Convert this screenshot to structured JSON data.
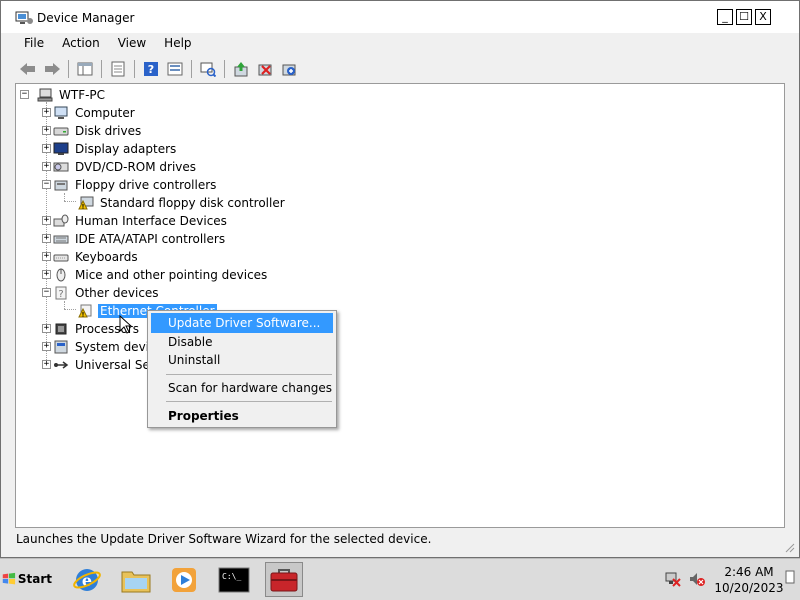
{
  "window": {
    "title": "Device Manager",
    "controls": {
      "minimize": "_",
      "maximize": "☐",
      "close": "X"
    }
  },
  "menu": [
    "File",
    "Action",
    "View",
    "Help"
  ],
  "toolbar": {
    "icons": [
      "back-arrow-icon",
      "forward-arrow-icon",
      "show-hide-tree-icon",
      "properties-sheet-icon",
      "help-icon",
      "view-icon",
      "scan-hardware-icon",
      "update-driver-icon",
      "uninstall-icon",
      "enable-device-icon"
    ]
  },
  "tree": {
    "root": "WTF-PC",
    "categories": [
      {
        "label": "Computer",
        "expander": "+"
      },
      {
        "label": "Disk drives",
        "expander": "+"
      },
      {
        "label": "Display adapters",
        "expander": "+"
      },
      {
        "label": "DVD/CD-ROM drives",
        "expander": "+"
      },
      {
        "label": "Floppy drive controllers",
        "expander": "−",
        "children": [
          "Standard floppy disk controller"
        ]
      },
      {
        "label": "Human Interface Devices",
        "expander": "+"
      },
      {
        "label": "IDE ATA/ATAPI controllers",
        "expander": "+"
      },
      {
        "label": "Keyboards",
        "expander": "+"
      },
      {
        "label": "Mice and other pointing devices",
        "expander": "+"
      },
      {
        "label": "Other devices",
        "expander": "−",
        "children": [
          "Ethernet Controller"
        ]
      },
      {
        "label": "Processors",
        "expander": "+"
      },
      {
        "label": "System devices",
        "expander": "+"
      },
      {
        "label": "Universal Serial Bus controllers",
        "expander": "+"
      }
    ]
  },
  "context_menu": [
    {
      "label": "Update Driver Software...",
      "highlighted": true
    },
    {
      "label": "Disable"
    },
    {
      "label": "Uninstall"
    },
    {
      "label": "Scan for hardware changes"
    },
    {
      "label": "Properties",
      "bold": true
    }
  ],
  "status_text": "Launches the Update Driver Software Wizard for the selected device.",
  "taskbar": {
    "start_label": "Start",
    "apps": [
      "internet-explorer-icon",
      "windows-explorer-icon",
      "media-player-icon",
      "command-prompt-icon",
      "device-manager-toolbox-icon"
    ],
    "time": "2:46 AM",
    "date": "10/20/2023"
  },
  "colors": {
    "selection": "#3399ff",
    "window_bg": "#f0f0f0",
    "taskbar_bg": "#dcdcdc"
  }
}
